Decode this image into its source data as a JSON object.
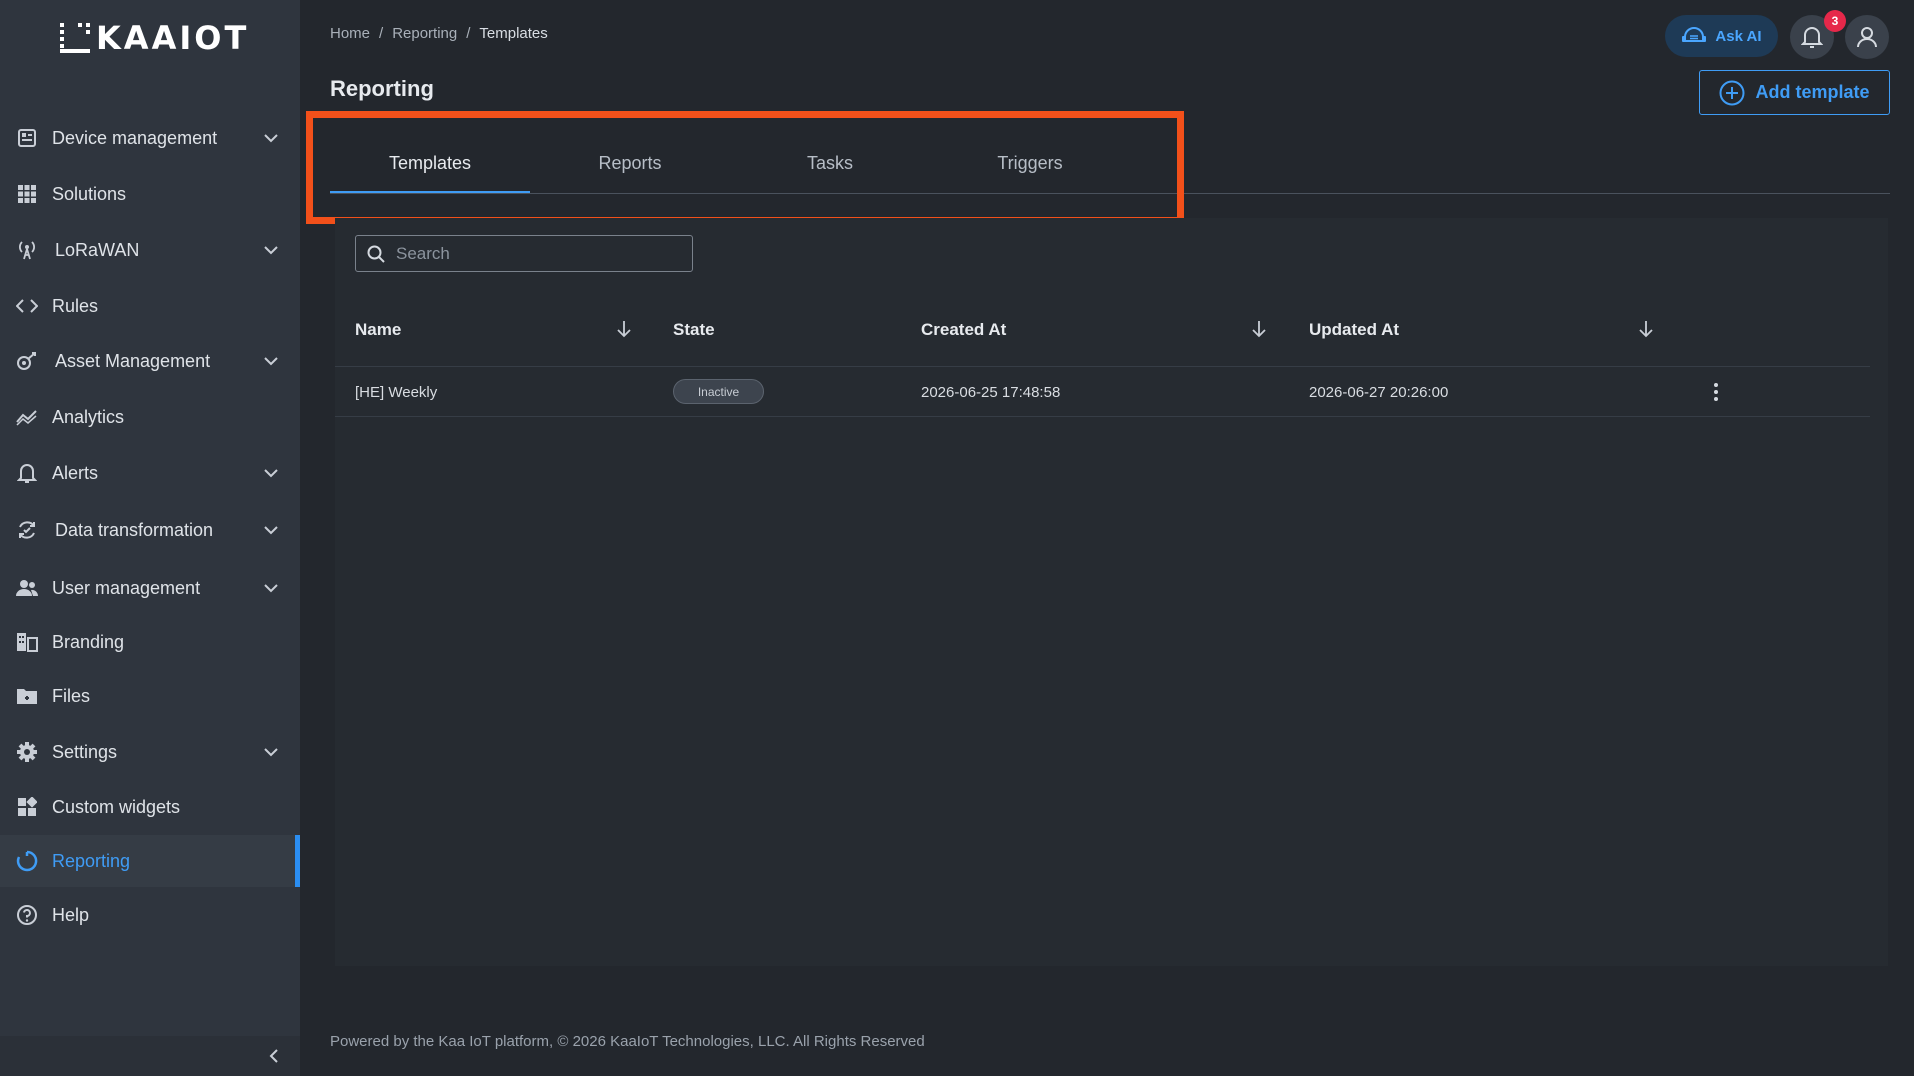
{
  "app": {
    "logo_text": "KAAIOT"
  },
  "sidebar": {
    "items": [
      {
        "label": "Device management",
        "icon": "device-management-icon",
        "expandable": true
      },
      {
        "label": "Solutions",
        "icon": "grid-icon",
        "expandable": false
      },
      {
        "label": "LoRaWAN",
        "icon": "antenna-icon",
        "expandable": true
      },
      {
        "label": "Rules",
        "icon": "code-icon",
        "expandable": false
      },
      {
        "label": "Asset Management",
        "icon": "asset-icon",
        "expandable": true
      },
      {
        "label": "Analytics",
        "icon": "analytics-icon",
        "expandable": false
      },
      {
        "label": "Alerts",
        "icon": "bell-icon",
        "expandable": true
      },
      {
        "label": "Data transformation",
        "icon": "transform-icon",
        "expandable": true
      },
      {
        "label": "User management",
        "icon": "users-icon",
        "expandable": true
      },
      {
        "label": "Branding",
        "icon": "branding-icon",
        "expandable": false
      },
      {
        "label": "Files",
        "icon": "folder-icon",
        "expandable": false
      },
      {
        "label": "Settings",
        "icon": "gear-icon",
        "expandable": true
      },
      {
        "label": "Custom widgets",
        "icon": "widgets-icon",
        "expandable": false
      },
      {
        "label": "Reporting",
        "icon": "reporting-icon",
        "expandable": false,
        "active": true
      },
      {
        "label": "Help",
        "icon": "help-icon",
        "expandable": false
      }
    ]
  },
  "header": {
    "breadcrumb": [
      "Home",
      "Reporting",
      "Templates"
    ],
    "separator": "/",
    "title": "Reporting",
    "ask_ai_label": "Ask AI",
    "notification_count": "3",
    "add_template_label": "Add template"
  },
  "tabs": [
    {
      "label": "Templates",
      "active": true
    },
    {
      "label": "Reports",
      "active": false
    },
    {
      "label": "Tasks",
      "active": false
    },
    {
      "label": "Triggers",
      "active": false
    }
  ],
  "search": {
    "placeholder": "Search",
    "value": ""
  },
  "table": {
    "columns": [
      "Name",
      "State",
      "Created At",
      "Updated At"
    ],
    "rows": [
      {
        "name": "[HE] Weekly",
        "state": "Inactive",
        "created_at": "2026-06-25 17:48:58",
        "updated_at": "2026-06-27 20:26:00"
      }
    ]
  },
  "footer": {
    "text": "Powered by the Kaa IoT platform, © 2026 KaaIoT Technologies, LLC. All Rights Reserved"
  },
  "colors": {
    "accent": "#3f9cf5",
    "highlight": "#f2501a",
    "badge": "#e6284a",
    "sidebar_bg": "#2f353e",
    "page_bg": "#23272d"
  }
}
